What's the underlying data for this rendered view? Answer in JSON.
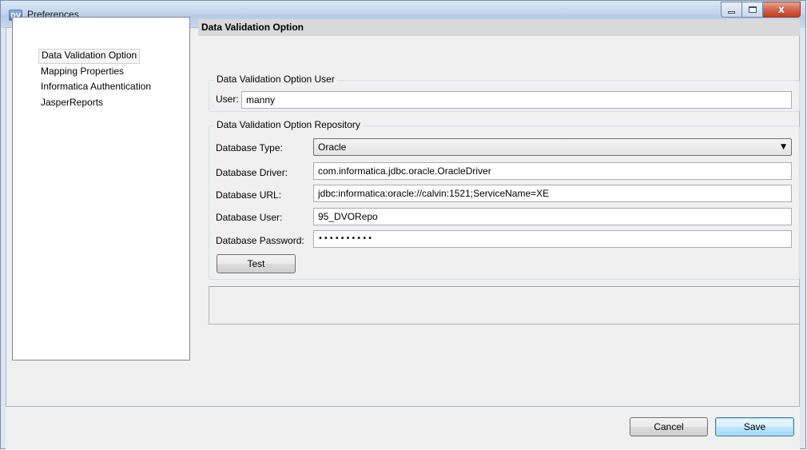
{
  "window": {
    "app_icon": "DV",
    "title": "Preferences",
    "controls": {
      "minimize_icon": "minimize-icon",
      "maximize_icon": "maximize-icon",
      "close_icon": "close-icon",
      "close_glyph": "x"
    }
  },
  "nav": {
    "items": [
      {
        "label": "Data Validation Option",
        "selected": true
      },
      {
        "label": "Mapping Properties",
        "selected": false
      },
      {
        "label": "Informatica Authentication",
        "selected": false
      },
      {
        "label": "JasperReports",
        "selected": false
      }
    ]
  },
  "page": {
    "header": "Data Validation Option",
    "user_group": {
      "title": "Data Validation Option User",
      "user_label": "User:",
      "user_value": "manny"
    },
    "repo_group": {
      "title": "Data Validation Option Repository",
      "db_type_label": "Database Type:",
      "db_type_value": "Oracle",
      "db_driver_label": "Database Driver:",
      "db_driver_value": "com.informatica.jdbc.oracle.OracleDriver",
      "db_url_label": "Database URL:",
      "db_url_value": "jdbc:informatica:oracle://calvin:1521;ServiceName=XE",
      "db_user_label": "Database User:",
      "db_user_value": "95_DVORepo",
      "db_password_label": "Database Password:",
      "db_password_value": "••••••••••",
      "test_label": "Test"
    }
  },
  "footer": {
    "cancel_label": "Cancel",
    "save_label": "Save"
  },
  "colors": {
    "titlebar": "#c4d6ec",
    "close_button": "#c43c22",
    "header_bar": "#d9d9d9",
    "default_button_border": "#3c7fb1"
  }
}
